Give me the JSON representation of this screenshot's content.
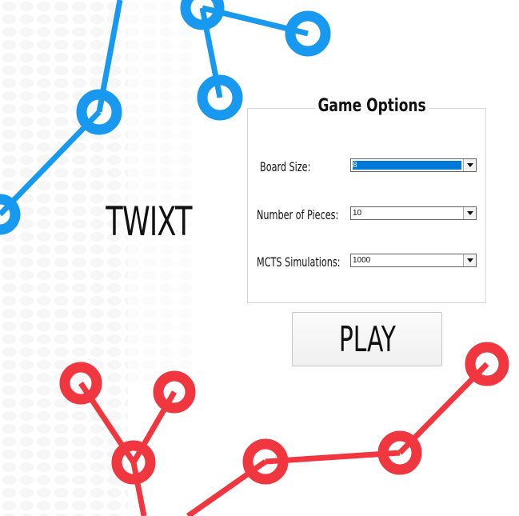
{
  "app": {
    "title": "TWIXT"
  },
  "options": {
    "legend": "Game Options",
    "board_size": {
      "label": "Board Size:",
      "selected": "8"
    },
    "pieces": {
      "label": "Number of Pieces:",
      "selected": "10"
    },
    "simulations": {
      "label": "MCTS Simulations:",
      "selected": "1000"
    }
  },
  "actions": {
    "play_label": "PLAY"
  },
  "colors": {
    "blue_pegs": "#1899f0",
    "red_pegs": "#f0363f",
    "select_highlight": "#0078d7",
    "dot_pattern": "#f0f0f0"
  }
}
